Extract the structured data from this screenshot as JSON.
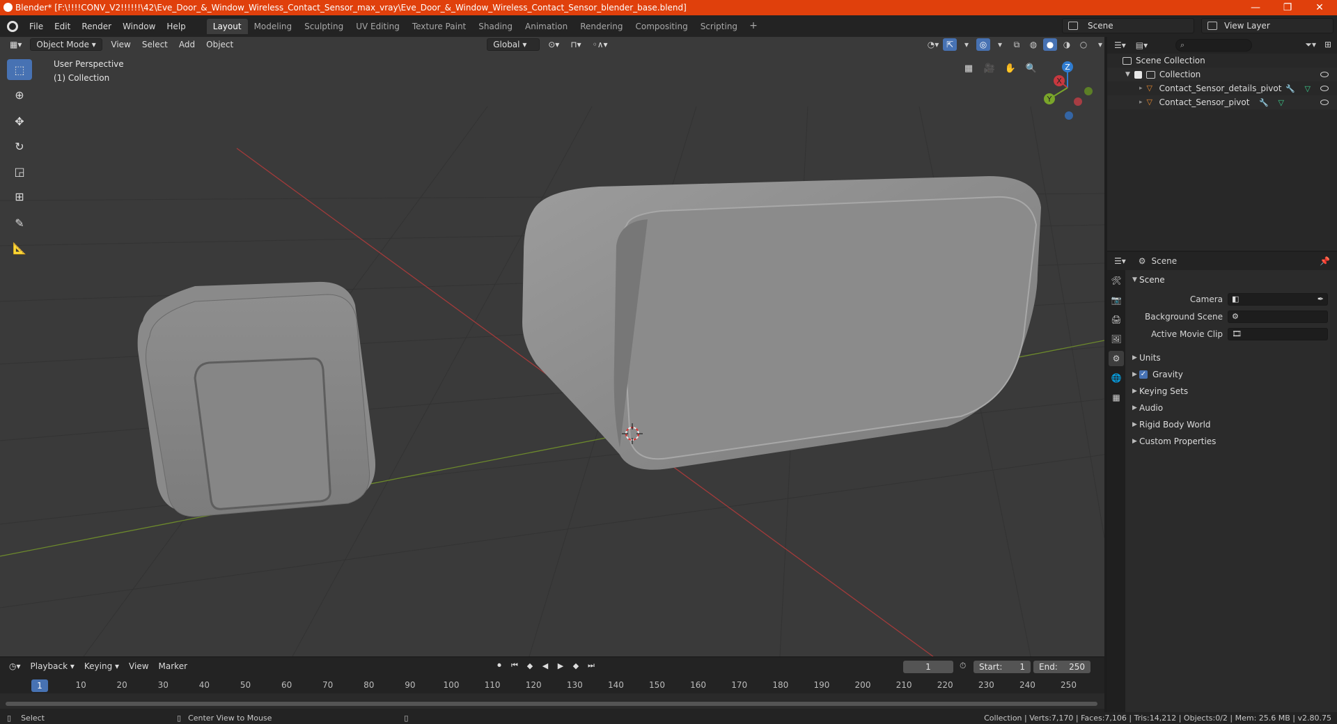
{
  "window": {
    "title": "Blender* [F:\\!!!!CONV_V2!!!!!!\\42\\Eve_Door_&_Window_Wireless_Contact_Sensor_max_vray\\Eve_Door_&_Window_Wireless_Contact_Sensor_blender_base.blend]",
    "minimize": "—",
    "restore": "❐",
    "close": "✕"
  },
  "menu": [
    "File",
    "Edit",
    "Render",
    "Window",
    "Help"
  ],
  "workspaces": [
    "Layout",
    "Modeling",
    "Sculpting",
    "UV Editing",
    "Texture Paint",
    "Shading",
    "Animation",
    "Rendering",
    "Compositing",
    "Scripting"
  ],
  "active_workspace": "Layout",
  "scene_selector": "Scene",
  "view_layer_selector": "View Layer",
  "viewport": {
    "mode": "Object Mode",
    "menus": [
      "View",
      "Select",
      "Add",
      "Object"
    ],
    "orientation": "Global",
    "view_name": "User Perspective",
    "collection_label": "(1) Collection",
    "gizmo_axes": [
      "Z",
      "X",
      "Y"
    ]
  },
  "tools": [
    "select-box-icon",
    "cursor-icon",
    "move-icon",
    "rotate-icon",
    "scale-icon",
    "transform-icon",
    "annotate-icon",
    "measure-icon"
  ],
  "timeline": {
    "menus": [
      "Playback",
      "Keying",
      "View",
      "Marker"
    ],
    "current_frame": "1",
    "start_label": "Start:",
    "start": "1",
    "end_label": "End:",
    "end": "250",
    "ruler_ticks": [
      "1",
      "10",
      "20",
      "30",
      "40",
      "50",
      "60",
      "70",
      "80",
      "90",
      "100",
      "110",
      "120",
      "130",
      "140",
      "150",
      "160",
      "170",
      "180",
      "190",
      "200",
      "210",
      "220",
      "230",
      "240",
      "250"
    ]
  },
  "status": {
    "left_action": "Select",
    "middle_action": "Center View to Mouse",
    "stats": "Collection | Verts:7,170 | Faces:7,106 | Tris:14,212 | Objects:0/2 | Mem: 25.6 MB | v2.80.75"
  },
  "outliner": {
    "root": "Scene Collection",
    "collection": "Collection",
    "objects": [
      "Contact_Sensor_details_pivot",
      "Contact_Sensor_pivot"
    ]
  },
  "properties": {
    "header": "Scene",
    "panel_title": "Scene",
    "fields": [
      {
        "label": "Camera"
      },
      {
        "label": "Background Scene"
      },
      {
        "label": "Active Movie Clip"
      }
    ],
    "subpanels": [
      "Units",
      "Gravity",
      "Keying Sets",
      "Audio",
      "Rigid Body World",
      "Custom Properties"
    ],
    "gravity_checked": true
  },
  "colors": {
    "titlebar": "#e0400c",
    "accent": "#4772b3",
    "x_axis": "#c8383f",
    "y_axis": "#7aa52a",
    "z_axis": "#2f7cd0",
    "mesh": "#e8892f"
  }
}
